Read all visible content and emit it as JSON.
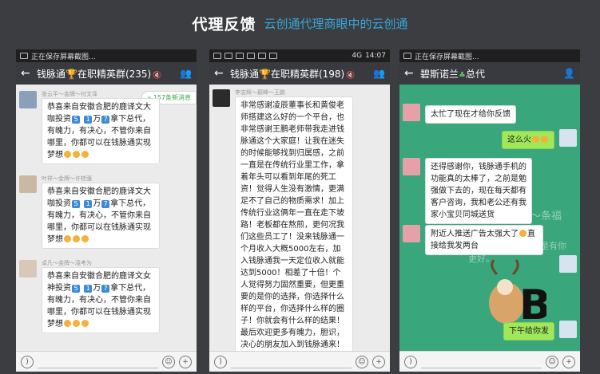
{
  "banner": {
    "title": "代理反馈",
    "subtitle": "云创通代理商眼中的云创通"
  },
  "phone1": {
    "status": "正在保存屏幕截图...",
    "chat_title": "钱脉通",
    "chat_title_suffix": "在职精英群(235)",
    "new_messages": "157条新消息",
    "messages": [
      {
        "sender": "张云平～金牌～付文泽",
        "text_a": "恭喜来自安徽合肥的鹿译文大咖投资",
        "num1": "5",
        "num2": "1",
        "text_b": "万",
        "num3": "7",
        "text_c": "拿下总代，有魄力，有决心，不管你来自哪里，你都可以在钱脉通实现梦想"
      },
      {
        "sender": "叶祥～金牌～许桂强",
        "text_a": "恭喜来自安徽合肥的鹿译文大咖投资",
        "num1": "5",
        "num2": "1",
        "text_b": "万",
        "num3": "7",
        "text_c": "拿下总代，有魄力，有决心，不管你来自哪里，你都可以在钱脉通实现梦想"
      },
      {
        "sender": "卓凡～金牌～凌考为",
        "text_a": "恭喜来自安徽合肥的鹿译文女神投资",
        "num1": "5",
        "num2": "1",
        "text_b": "万",
        "num3": "7",
        "text_c": "拿下总代，有魄力，有决心，不管你来自哪里，你都可以在钱脉通实现梦想"
      }
    ]
  },
  "phone2": {
    "status_time": "14:07",
    "status_net": "4G",
    "chat_title": "钱脉通",
    "chat_title_suffix": "在职精英群(198)",
    "sender": "李志辉～巅峰～王鹏",
    "message": "非常感谢凌辰董事长和黄俊老师搭建这么好的一个平台，也非常感谢王鹏老师带我走进钱脉通这个大家庭！让我在迷失的时候能够找到归属感，之前一直是在传统行业里工作，拿着年头可以看到年尾的死工资！觉得人生没有激情，更满足不了自己的物质需求！加上传统行业这俩年一直在走下坡路！老板都在熬煎，更何况我们这些员工了！没来钱脉通一个月收入大概5000左右，加入钱脉通我一天定位收入就能达到5000！相差了十倍！个人觉得努力固然重要，但更重要的是你的选择，你选择什么样的平台，你选择什么样的圈子！你就会有什么样的结果！最后欢迎更多有魄力，胆识，决心的朋友加入到钱脉通来！我们一直提升个人能力，一起提升个人财富，一起去帮助到更"
  },
  "phone3": {
    "status": "正在保存屏幕截图...",
    "chat_title": "碧斯诺兰",
    "chat_title_suffix": "总代",
    "watermark1": "群宇团队～条福",
    "watermark2": "是有你",
    "watermark3": "更好。",
    "messages": {
      "m1": "太忙了现在才给你反馈",
      "m2": "这么火",
      "m3": "还得感谢你，钱脉通手机的功能真的太棒了，之前是勉强做下去的，现在每天都有客户咨询，我和老公还有我家小宝贝同城送货",
      "m4": "附近人推送广告太强大了",
      "m4b": "直接给我发两台",
      "m5": "下午给你发"
    }
  },
  "colors": {
    "accent": "#39a7dc",
    "titlebar": "#393a3f",
    "bubble_green": "#a0e75a",
    "chat_bg_green": "#3aa67c"
  }
}
